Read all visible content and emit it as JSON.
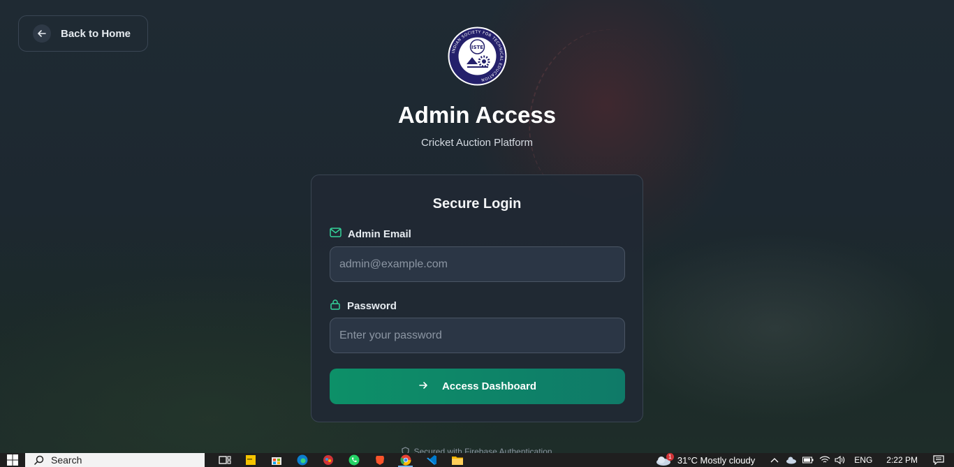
{
  "back": {
    "label": "Back to Home"
  },
  "header": {
    "title": "Admin Access",
    "subtitle": "Cricket Auction Platform",
    "logo_text": "ISTE",
    "logo_ring_text": "INDIAN SOCIETY FOR TECHNICAL EDUCATION"
  },
  "login": {
    "title": "Secure Login",
    "email_label": "Admin Email",
    "email_placeholder": "admin@example.com",
    "password_label": "Password",
    "password_placeholder": "Enter your password",
    "submit_label": "Access Dashboard"
  },
  "footer": {
    "note": "Secured with Firebase Authentication"
  },
  "taskbar": {
    "search_label": "Search",
    "apps": [
      "task-view-icon",
      "sticky-notes-icon",
      "store-icon",
      "edge-icon",
      "paint-icon",
      "whatsapp-icon",
      "brave-icon",
      "chrome-icon",
      "vscode-icon",
      "file-explorer-icon"
    ],
    "weather_badge": "1",
    "weather": "31°C  Mostly cloudy",
    "language": "ENG",
    "time": "2:22 PM"
  },
  "colors": {
    "accent": "#0d9068",
    "icon_green": "#34d399"
  }
}
